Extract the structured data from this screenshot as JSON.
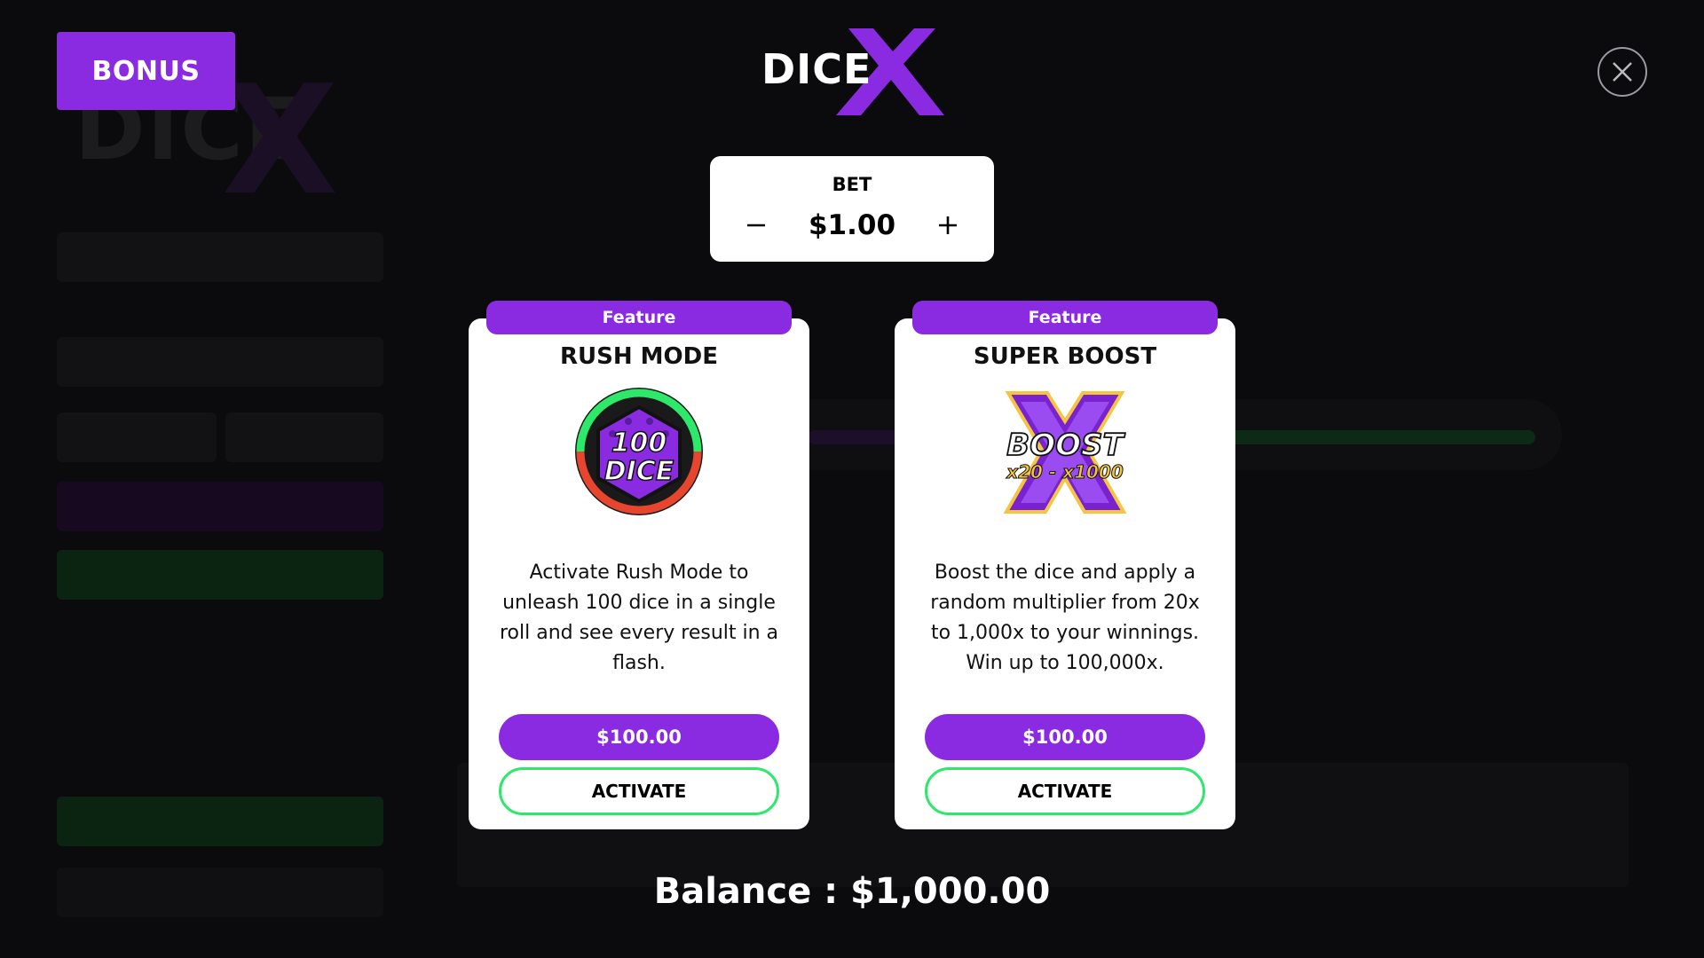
{
  "colors": {
    "accent_purple": "#8a2be2",
    "activate_border_green": "#2ee86a",
    "overlay_background": "#0b0b0d",
    "card_background": "#ffffff"
  },
  "bonus_tag": {
    "label": "BONUS"
  },
  "logo": {
    "text": "DICE",
    "icon": "dice-x-logo"
  },
  "close_button": {
    "icon": "close-icon"
  },
  "bet": {
    "label": "BET",
    "value": "$1.00",
    "decrement_icon": "minus-icon",
    "increment_icon": "plus-icon"
  },
  "cards": [
    {
      "ribbon": "Feature",
      "title": "RUSH MODE",
      "art_icon": "hundred-dice-icon",
      "art_text_line1": "100",
      "art_text_line2": "DICE",
      "description": "Activate Rush Mode to unleash 100 dice in a single roll and see every result in a flash.",
      "price": "$100.00",
      "activate_label": "ACTIVATE"
    },
    {
      "ribbon": "Feature",
      "title": "SUPER BOOST",
      "art_icon": "boost-x-icon",
      "art_text_line1": "BOOST",
      "art_text_line2": "x20 - x1000",
      "description": "Boost the dice and apply a random multiplier from 20x to 1,000x to your winnings. Win up to 100,000x.",
      "price": "$100.00",
      "activate_label": "ACTIVATE"
    }
  ],
  "balance": {
    "text": "Balance : $1,000.00"
  }
}
